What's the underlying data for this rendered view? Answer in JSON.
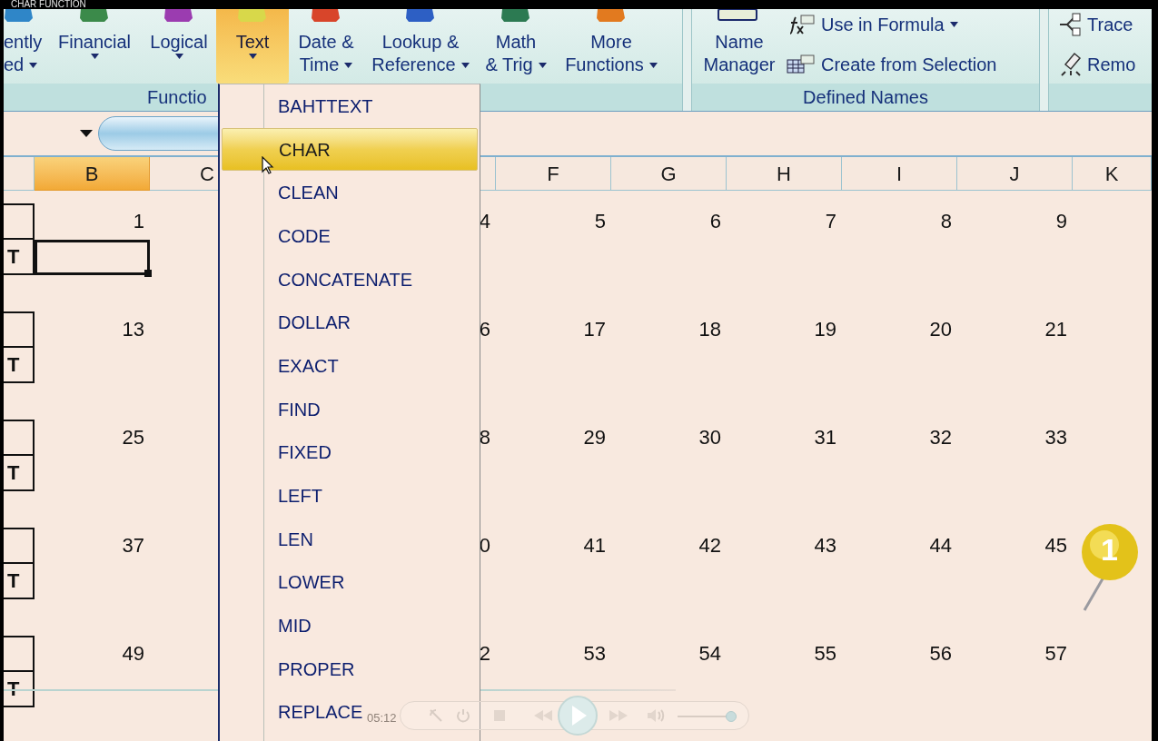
{
  "video_title": "CHAR FUNCTION",
  "ribbon": {
    "function_group": {
      "label": "Functio",
      "buttons": [
        {
          "lines": [
            "ently",
            "ed"
          ],
          "dropdown": true,
          "selected": false
        },
        {
          "lines": [
            "Financial"
          ],
          "dropdown": true,
          "selected": false
        },
        {
          "lines": [
            "Logical"
          ],
          "dropdown": true,
          "selected": false
        },
        {
          "lines": [
            "Text"
          ],
          "dropdown": true,
          "selected": true
        },
        {
          "lines": [
            "Date &",
            "Time"
          ],
          "dropdown": true,
          "selected": false
        },
        {
          "lines": [
            "Lookup &",
            "Reference"
          ],
          "dropdown": true,
          "selected": false
        },
        {
          "lines": [
            "Math",
            "& Trig"
          ],
          "dropdown": true,
          "selected": false
        },
        {
          "lines": [
            "More",
            "Functions"
          ],
          "dropdown": true,
          "selected": false
        }
      ]
    },
    "defined_names": {
      "label": "Defined Names",
      "large_button": {
        "lines": [
          "Name",
          "Manager"
        ]
      },
      "small_buttons": [
        {
          "label": "Use in Formula",
          "dropdown": true
        },
        {
          "label": "Create from Selection",
          "dropdown": false
        }
      ]
    },
    "auditing": {
      "small_buttons": [
        {
          "label": "Trace"
        },
        {
          "label": "Remo"
        }
      ]
    }
  },
  "column_headers": [
    {
      "label": "B",
      "selected": true
    },
    {
      "label": "C",
      "selected": false
    },
    {
      "label": "F",
      "selected": false
    },
    {
      "label": "G",
      "selected": false
    },
    {
      "label": "H",
      "selected": false
    },
    {
      "label": "I",
      "selected": false
    },
    {
      "label": "J",
      "selected": false
    },
    {
      "label": "K",
      "selected": false
    }
  ],
  "blocks": [
    {
      "numbers": [
        "1",
        "4",
        "5",
        "6",
        "7",
        "8",
        "9"
      ],
      "label": "T",
      "selected": true
    },
    {
      "numbers": [
        "13",
        "6",
        "17",
        "18",
        "19",
        "20",
        "21"
      ],
      "label": "T",
      "selected": false
    },
    {
      "numbers": [
        "25",
        "8",
        "29",
        "30",
        "31",
        "32",
        "33"
      ],
      "label": "T",
      "selected": false
    },
    {
      "numbers": [
        "37",
        "0",
        "41",
        "42",
        "43",
        "44",
        "45"
      ],
      "label": "T",
      "selected": false
    },
    {
      "numbers": [
        "49",
        "2",
        "53",
        "54",
        "55",
        "56",
        "57"
      ],
      "label": "T",
      "selected": false
    }
  ],
  "menu": {
    "items": [
      {
        "label": "BAHTTEXT",
        "selected": false
      },
      {
        "label": "CHAR",
        "selected": true
      },
      {
        "label": "CLEAN",
        "selected": false
      },
      {
        "label": "CODE",
        "selected": false
      },
      {
        "label": "CONCATENATE",
        "selected": false
      },
      {
        "label": "DOLLAR",
        "selected": false
      },
      {
        "label": "EXACT",
        "selected": false
      },
      {
        "label": "FIND",
        "selected": false
      },
      {
        "label": "FIXED",
        "selected": false
      },
      {
        "label": "LEFT",
        "selected": false
      },
      {
        "label": "LEN",
        "selected": false
      },
      {
        "label": "LOWER",
        "selected": false
      },
      {
        "label": "MID",
        "selected": false
      },
      {
        "label": "PROPER",
        "selected": false
      },
      {
        "label": "REPLACE",
        "selected": false
      }
    ]
  },
  "pin": {
    "label": "1"
  },
  "player": {
    "time": "05:12",
    "volume": {
      "level": 0.92
    }
  }
}
